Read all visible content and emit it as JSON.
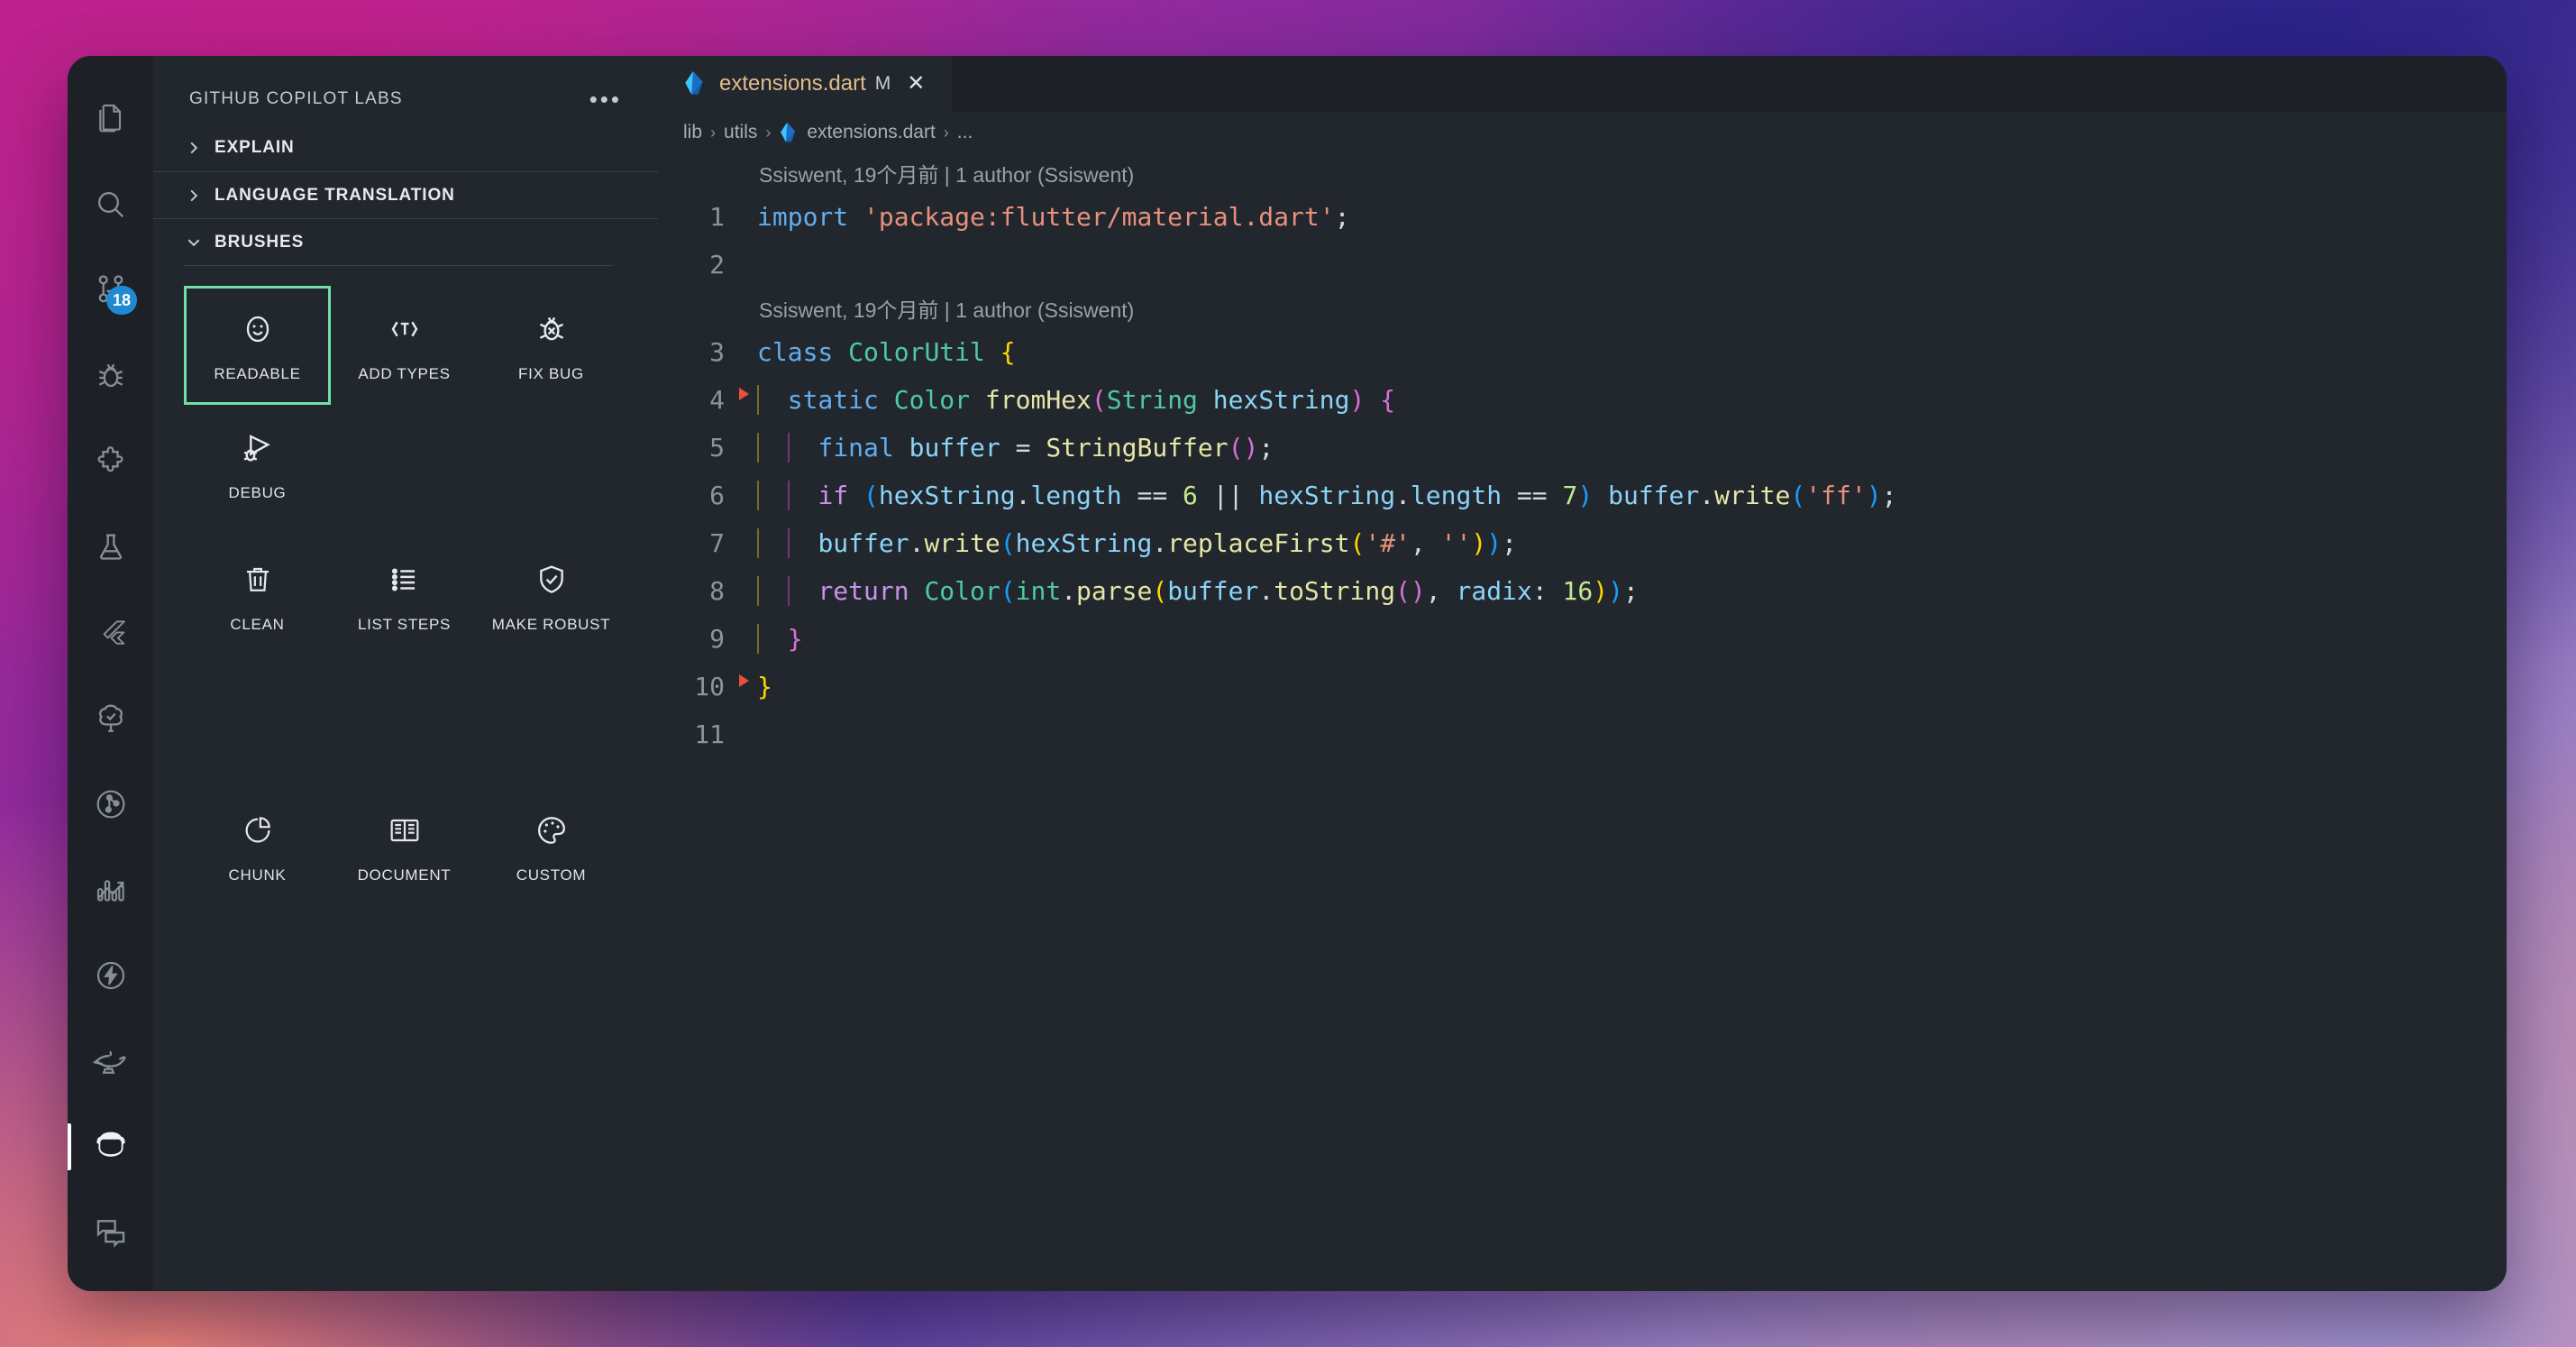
{
  "activity_bar": {
    "items": [
      {
        "name": "explorer",
        "icon": "files-icon",
        "badge": null,
        "active": false
      },
      {
        "name": "search",
        "icon": "search-icon",
        "badge": null,
        "active": false
      },
      {
        "name": "source-control",
        "icon": "source-control-icon",
        "badge": "18",
        "active": false
      },
      {
        "name": "run-and-debug",
        "icon": "debug-icon",
        "badge": null,
        "active": false
      },
      {
        "name": "extensions",
        "icon": "extensions-icon",
        "badge": null,
        "active": false
      },
      {
        "name": "testing",
        "icon": "beaker-icon",
        "badge": null,
        "active": false
      },
      {
        "name": "flutter",
        "icon": "flutter-icon",
        "badge": null,
        "active": false
      },
      {
        "name": "dependency-tree",
        "icon": "tree-check-icon",
        "badge": null,
        "active": false
      },
      {
        "name": "call-graph",
        "icon": "graph-circle-icon",
        "badge": null,
        "active": false
      },
      {
        "name": "analytics",
        "icon": "chart-arrow-icon",
        "badge": null,
        "active": false
      },
      {
        "name": "performance",
        "icon": "lightning-icon",
        "badge": null,
        "active": false
      },
      {
        "name": "genie",
        "icon": "lamp-icon",
        "badge": null,
        "active": false
      },
      {
        "name": "copilot-labs",
        "icon": "copilot-icon",
        "badge": null,
        "active": true
      },
      {
        "name": "comments",
        "icon": "comments-icon",
        "badge": null,
        "active": false
      }
    ]
  },
  "panel": {
    "title": "GITHUB COPILOT LABS",
    "more_label": "•••",
    "sections": [
      {
        "label": "EXPLAIN",
        "expanded": false,
        "chevron": "chevron-right-icon"
      },
      {
        "label": "LANGUAGE TRANSLATION",
        "expanded": false,
        "chevron": "chevron-right-icon"
      },
      {
        "label": "BRUSHES",
        "expanded": true,
        "chevron": "chevron-down-icon"
      }
    ],
    "brushes": [
      {
        "label": "READABLE",
        "icon": "smiley-icon",
        "selected": true
      },
      {
        "label": "ADD TYPES",
        "icon": "add-types-icon",
        "selected": false
      },
      {
        "label": "FIX BUG",
        "icon": "bug-x-icon",
        "selected": false
      },
      {
        "label": "DEBUG",
        "icon": "bug-play-icon",
        "selected": false
      },
      {
        "label": "CLEAN",
        "icon": "trash-icon",
        "selected": false
      },
      {
        "label": "LIST STEPS",
        "icon": "list-icon",
        "selected": false
      },
      {
        "label": "MAKE ROBUST",
        "icon": "shield-check-icon",
        "selected": false
      },
      {
        "label": "CHUNK",
        "icon": "pie-chart-icon",
        "selected": false
      },
      {
        "label": "DOCUMENT",
        "icon": "book-icon",
        "selected": false
      },
      {
        "label": "CUSTOM",
        "icon": "palette-icon",
        "selected": false
      }
    ],
    "selection_color": "#6fdfa4"
  },
  "editor": {
    "tab": {
      "filename": "extensions.dart",
      "modified_badge": "M",
      "close_label": "✕",
      "icon": "dart-file-icon"
    },
    "breadcrumb": {
      "parts": [
        "lib",
        "utils",
        "extensions.dart",
        "..."
      ],
      "separator": "›"
    },
    "blame_lines": [
      {
        "before_line": 1,
        "text": "Ssiswent, 19个月前 | 1 author (Ssiswent)"
      },
      {
        "before_line": 3,
        "text": "Ssiswent, 19个月前 | 1 author (Ssiswent)"
      }
    ],
    "lines": [
      {
        "n": "1",
        "text": "import 'package:flutter/material.dart';"
      },
      {
        "n": "2",
        "text": ""
      },
      {
        "n": "3",
        "text": "class ColorUtil {"
      },
      {
        "n": "4",
        "text": "  static Color fromHex(String hexString) {"
      },
      {
        "n": "5",
        "text": "    final buffer = StringBuffer();"
      },
      {
        "n": "6",
        "text": "    if (hexString.length == 6 || hexString.length == 7) buffer.write('ff');"
      },
      {
        "n": "7",
        "text": "    buffer.write(hexString.replaceFirst('#', ''));"
      },
      {
        "n": "8",
        "text": "    return Color(int.parse(buffer.toString(), radix: 16));"
      },
      {
        "n": "9",
        "text": "  }"
      },
      {
        "n": "10",
        "text": "}"
      },
      {
        "n": "11",
        "text": ""
      }
    ],
    "fold_markers_after_lines": [
      "3",
      "9"
    ],
    "colors": {
      "background": "#22272e",
      "keyword": "#61aeee",
      "control_keyword": "#c792ea",
      "type": "#4ec9a8",
      "string": "#e8907c",
      "function": "#e6e6a6",
      "variable": "#8bd3f7",
      "number": "#c3e88d",
      "punctuation": "#d5dae0",
      "fold_marker": "#e8503a",
      "line_number": "#8b939c",
      "blame_text": "#9aa1a9"
    }
  }
}
